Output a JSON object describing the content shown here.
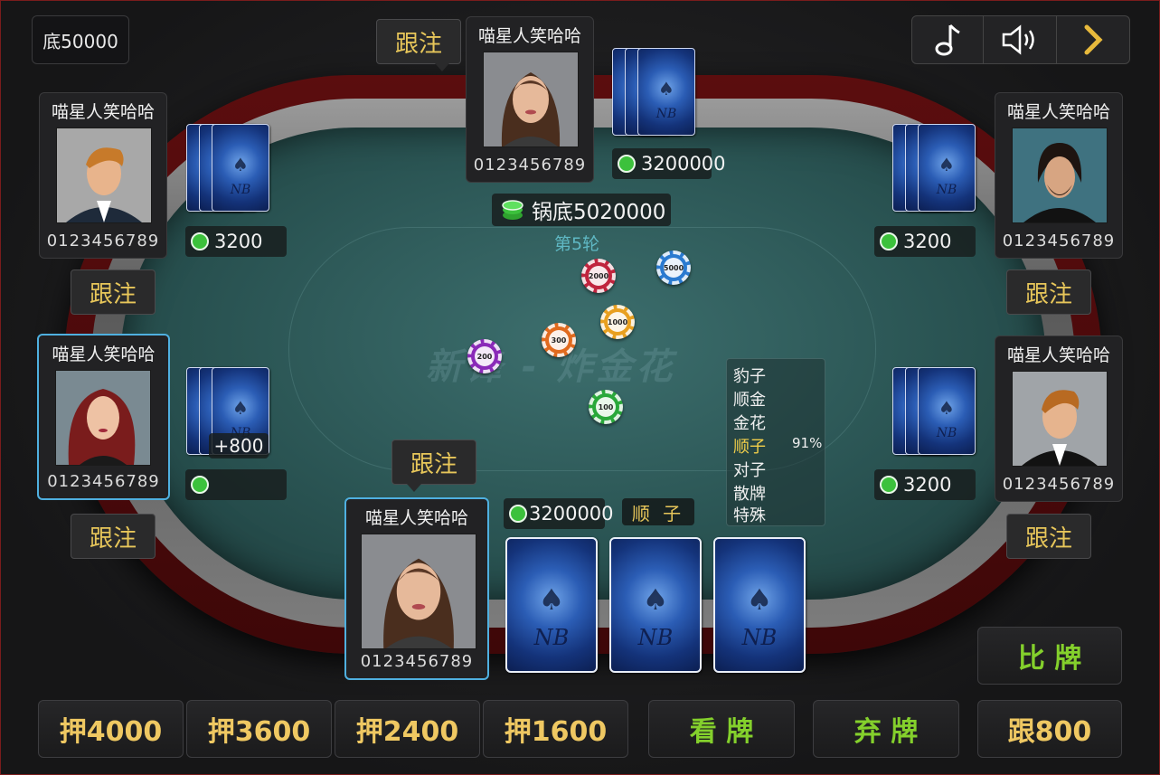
{
  "base_label": "底50000",
  "controls": {
    "music_icon": "music-note-icon",
    "sound_icon": "speaker-icon",
    "next_icon": "chevron-right-icon"
  },
  "table": {
    "watermark": "新锋 - 炸金花",
    "pot": "锅底5020000",
    "round": "第5轮"
  },
  "players": {
    "top": {
      "name": "喵星人笑哈哈",
      "id": "0123456789",
      "bet": "3200000",
      "action": "跟注"
    },
    "left1": {
      "name": "喵星人笑哈哈",
      "id": "0123456789",
      "bet": "3200",
      "action": "跟注"
    },
    "left2": {
      "name": "喵星人笑哈哈",
      "id": "0123456789",
      "bet": "",
      "gain": "+800",
      "action": "跟注"
    },
    "right1": {
      "name": "喵星人笑哈哈",
      "id": "0123456789",
      "bet": "3200",
      "action": "跟注"
    },
    "right2": {
      "name": "喵星人笑哈哈",
      "id": "0123456789",
      "bet": "3200",
      "action": "跟注"
    },
    "self": {
      "name": "喵星人笑哈哈",
      "id": "0123456789",
      "bet": "3200000",
      "action": "跟注",
      "hand_type": "顺 子"
    }
  },
  "chips": [
    "2000",
    "5000",
    "1000",
    "300",
    "200",
    "100"
  ],
  "hand_ranks": [
    "豹子",
    "顺金",
    "金花",
    "顺子",
    "对子",
    "散牌",
    "特殊"
  ],
  "hand_probability": "91%",
  "actions": {
    "compare": "比 牌",
    "bet1": "押4000",
    "bet2": "押3600",
    "bet3": "押2400",
    "bet4": "押1600",
    "look": "看 牌",
    "fold": "弃 牌",
    "follow": "跟800"
  },
  "colors": {
    "gold": "#efc862",
    "green": "#84d02c",
    "highlight": "#4fb0e0",
    "felt": "#2a5453",
    "rail": "#5b0d0e"
  }
}
